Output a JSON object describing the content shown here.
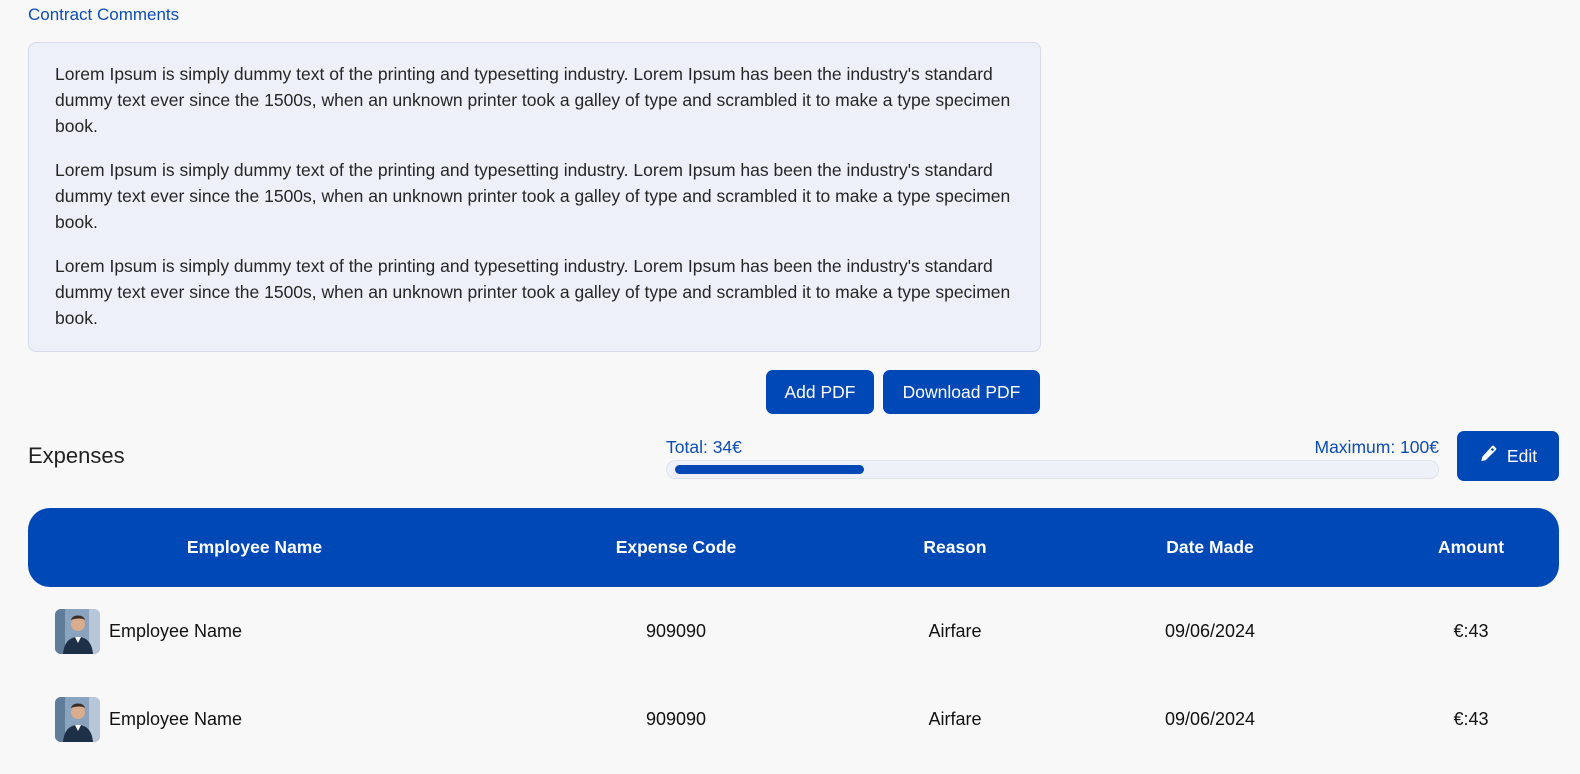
{
  "comments": {
    "title": "Contract Comments",
    "paragraphs": [
      "Lorem Ipsum is simply dummy text of the printing and typesetting industry. Lorem Ipsum has been the industry's standard dummy text ever since the 1500s, when an unknown printer took a galley of type and scrambled it to make a type specimen book.",
      "Lorem Ipsum is simply dummy text of the printing and typesetting industry. Lorem Ipsum has been the industry's standard dummy text ever since the 1500s, when an unknown printer took a galley of type and scrambled it to make a type specimen book.",
      "Lorem Ipsum is simply dummy text of the printing and typesetting industry. Lorem Ipsum has been the industry's standard dummy text ever since the 1500s, when an unknown printer took a galley of type and scrambled it to make a type specimen book."
    ],
    "add_pdf_label": "Add PDF",
    "download_pdf_label": "Download PDF"
  },
  "expenses": {
    "title": "Expenses",
    "total_label": "Total: 34€",
    "maximum_label": "Maximum: 100€",
    "progress_fraction": 0.25,
    "edit_label": "Edit",
    "edit_icon": "pencil-icon",
    "columns": [
      "Employee Name",
      "Expense Code",
      "Reason",
      "Date Made",
      "Amount"
    ],
    "rows": [
      {
        "employee": "Employee Name",
        "code": "909090",
        "reason": "Airfare",
        "date": "09/06/2024",
        "amount": "€:43"
      },
      {
        "employee": "Employee Name",
        "code": "909090",
        "reason": "Airfare",
        "date": "09/06/2024",
        "amount": "€:43"
      }
    ]
  },
  "colors": {
    "accent": "#0148b7",
    "link": "#0d4db3",
    "box_bg": "#edf0f8"
  }
}
